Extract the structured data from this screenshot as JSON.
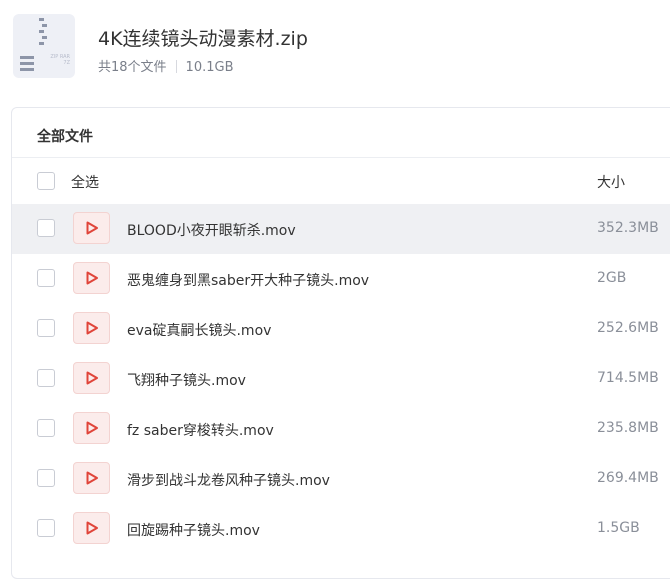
{
  "archive": {
    "title": "4K连续镜头动漫素材.zip",
    "count_text": "共18个文件",
    "total_size": "10.1GB",
    "icon": "zip-file-icon"
  },
  "panel": {
    "heading": "全部文件"
  },
  "list_header": {
    "select_all_label": "全选",
    "size_label": "大小"
  },
  "files": [
    {
      "name": "BLOOD小夜开眼斩杀.mov",
      "size": "352.3MB",
      "icon": "video-file-icon"
    },
    {
      "name": "恶鬼缠身到黑saber开大种子镜头.mov",
      "size": "2GB",
      "icon": "video-file-icon"
    },
    {
      "name": "eva碇真嗣长镜头.mov",
      "size": "252.6MB",
      "icon": "video-file-icon"
    },
    {
      "name": "飞翔种子镜头.mov",
      "size": "714.5MB",
      "icon": "video-file-icon"
    },
    {
      "name": "fz saber穿梭转头.mov",
      "size": "235.8MB",
      "icon": "video-file-icon"
    },
    {
      "name": "滑步到战斗龙卷风种子镜头.mov",
      "size": "269.4MB",
      "icon": "video-file-icon"
    },
    {
      "name": "回旋踢种子镜头.mov",
      "size": "1.5GB",
      "icon": "video-file-icon"
    }
  ],
  "colors": {
    "selected_row": "#eff0f3",
    "video_icon_bg": "#fbeceb",
    "video_icon_glyph": "#e0453a",
    "muted_text": "#8a8f99"
  }
}
